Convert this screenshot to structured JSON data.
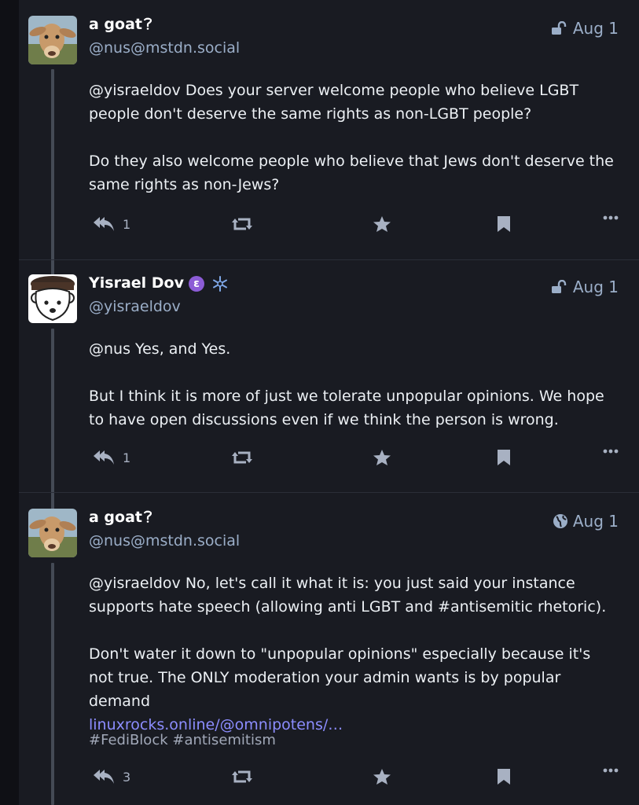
{
  "posts": [
    {
      "display_name": "a goat",
      "handle": "@nus@mstdn.social",
      "date": "Aug 1",
      "visibility_icon": "unlock-icon",
      "paragraphs": [
        "@yisraeldov Does your server welcome people who believe LGBT people don't deserve the same rights as non-LGBT people?",
        "Do they also welcome people who believe that Jews don't deserve the same rights as non-Jews?"
      ],
      "reply_count": "1"
    },
    {
      "display_name": "Yisrael Dov",
      "handle": "@yisraeldov",
      "date": "Aug 1",
      "visibility_icon": "unlock-icon",
      "badge_letter": "ε",
      "paragraphs": [
        "@nus Yes, and Yes.",
        "But I think it is more of just we tolerate unpopular opinions. We hope to have open discussions even if we think the person is wrong."
      ],
      "reply_count": "1"
    },
    {
      "display_name": "a goat",
      "handle": "@nus@mstdn.social",
      "date": "Aug 1",
      "visibility_icon": "globe-icon",
      "paragraphs": [
        "@yisraeldov No, let's call it what it is: you just said your instance supports hate speech (allowing anti LGBT and #antisemitic rhetoric).",
        "Don't water it down to \"unpopular opinions\" especially because it's not true. The ONLY moderation your admin wants is by popular demand"
      ],
      "link_text": "linuxrocks.online/@omnipotens/…",
      "tags": "#FediBlock #antisemitism",
      "reply_count": "3"
    }
  ],
  "colors": {
    "background": "#191b22",
    "text": "#ecf0f4",
    "muted": "#9baec8",
    "link": "#8c8dff",
    "badge": "#8c5cd6"
  }
}
